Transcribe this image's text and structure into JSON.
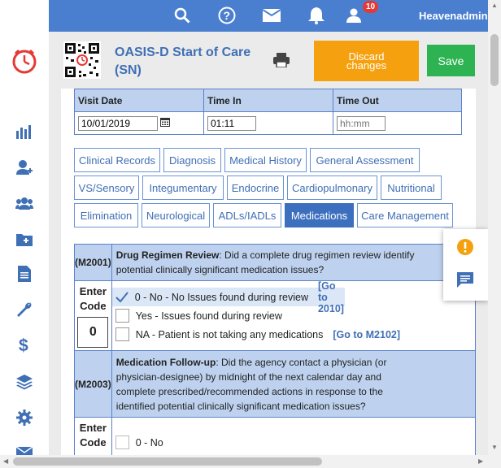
{
  "topbar": {
    "user_name": "Heavenadmin Mojica",
    "notification_count": "10",
    "icons": [
      "search-icon",
      "help-icon",
      "mail-icon",
      "bell-icon",
      "user-icon"
    ]
  },
  "sidebar": {
    "icons": [
      "logo-clock-icon",
      "bar-chart-icon",
      "add-patient-icon",
      "group-icon",
      "add-folder-icon",
      "document-icon",
      "wrench-icon",
      "dollar-icon",
      "layers-icon",
      "gear-icon",
      "mail-icon"
    ]
  },
  "header": {
    "title_line1": "OASIS-D Start of Care",
    "title_line2": "(SN)",
    "discard_label_line1": "Discard",
    "discard_label_line2": "changes",
    "save_label": "Save"
  },
  "visit": {
    "date_label": "Visit Date",
    "time_in_label": "Time In",
    "time_out_label": "Time Out",
    "date_value": "10/01/2019",
    "time_in_value": "01:11",
    "time_out_placeholder": "hh:mm"
  },
  "tabs": [
    {
      "label": "Clinical Records"
    },
    {
      "label": "Diagnosis"
    },
    {
      "label": "Medical History"
    },
    {
      "label": "General Assessment"
    },
    {
      "label": "VS/Sensory"
    },
    {
      "label": "Integumentary"
    },
    {
      "label": "Endocrine"
    },
    {
      "label": "Cardiopulmonary"
    },
    {
      "label": "Nutritional"
    },
    {
      "label": "Elimination"
    },
    {
      "label": "Neurological"
    },
    {
      "label": "ADLs/IADLs"
    },
    {
      "label": "Medications",
      "active": true
    },
    {
      "label": "Care Management"
    }
  ],
  "questions": {
    "m2001": {
      "code": "(M2001)",
      "title": "Drug Regimen Review",
      "text_line1": ": Did a complete drug regimen review identify",
      "text_line2": "potential clinically significant medication issues?",
      "enter_label": "Enter",
      "code_label": "Code",
      "code_value": "0",
      "options": [
        {
          "label": "0 - No - No Issues found during review",
          "goto": "[Go to 2010]",
          "selected": true
        },
        {
          "label": "Yes - Issues found during review",
          "goto": ""
        },
        {
          "label": "NA - Patient is not taking any medications",
          "goto": "[Go to M2102]"
        }
      ]
    },
    "m2003": {
      "code": "(M2003)",
      "title": "Medication Follow-up",
      "text_line1": ": Did the agency contact a physician (or",
      "text_line2": "physician-designee) by midnight of the next calendar day and",
      "text_line3": "complete prescribed/recommended actions in response to the",
      "text_line4": "identified potential clinically significant medication issues?",
      "enter_label": "Enter",
      "code_label": "Code",
      "options": [
        {
          "label": "0 - No"
        }
      ]
    }
  },
  "colors": {
    "topbar": "#4a7fd0",
    "discard": "#f5a10f",
    "save": "#2db351",
    "header_cell": "#bed2ef",
    "active_tab": "#3d6fbf",
    "link": "#3f6fb5"
  }
}
